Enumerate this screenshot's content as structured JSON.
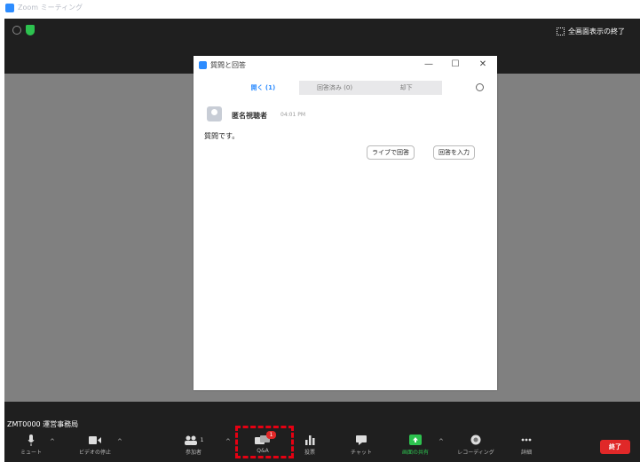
{
  "app": {
    "window_title": "Zoom ミーティング"
  },
  "topbar": {
    "speaker_view": "全画面表示の終了"
  },
  "qa": {
    "title": "質問と回答",
    "minimize": "—",
    "maximize": "☐",
    "close": "✕",
    "tabs": [
      "開く (1)",
      "回答済み (0)",
      "却下"
    ],
    "question": {
      "author": "匿名視聴者",
      "time": "04:01 PM",
      "text": "質問です。"
    },
    "answer_live": "ライブで回答",
    "type_answer": "回答を入力"
  },
  "toolbar": {
    "meeting_name": "ZMT0000 運営事務局",
    "mute": "ミュート",
    "stop_video": "ビデオの停止",
    "participants": "参加者",
    "participants_count": "1",
    "qa": "Q&A",
    "qa_badge": "1",
    "polling": "投票",
    "chat": "チャット",
    "share": "画面の共有",
    "record": "レコーディング",
    "more": "詳細",
    "end": "終了"
  },
  "colors": {
    "accent": "#2d8cff",
    "end": "#e02828",
    "share": "#2dc24f",
    "highlight": "#e60012"
  }
}
